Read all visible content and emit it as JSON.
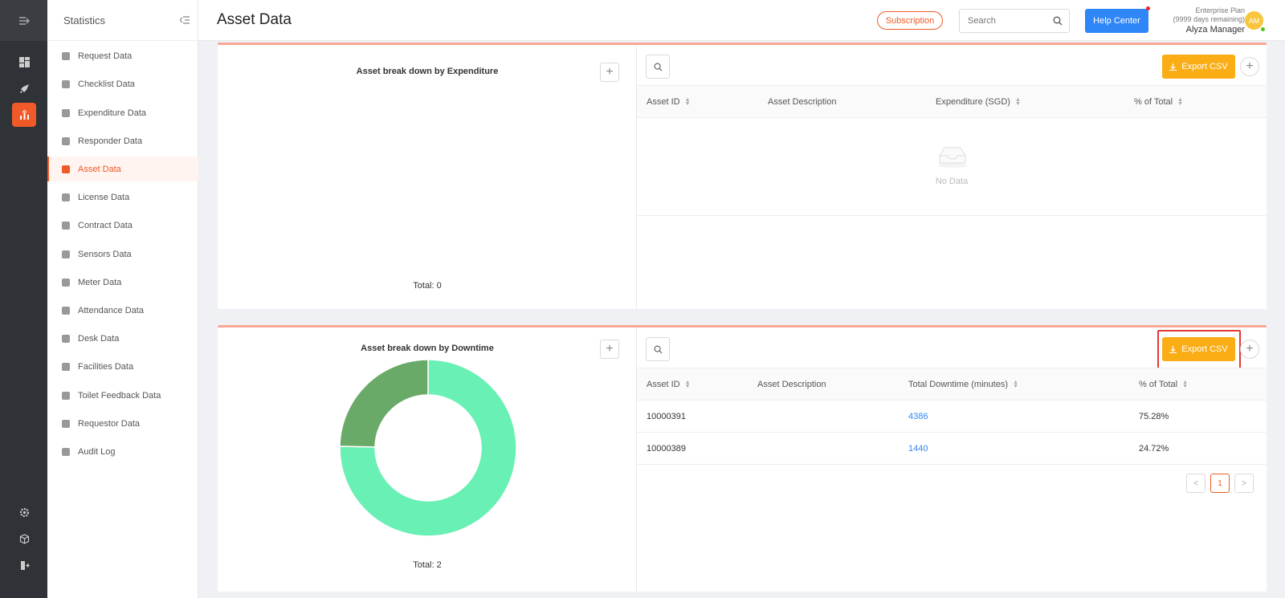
{
  "header": {
    "title": "Asset Data",
    "subscription_label": "Subscription",
    "search_placeholder": "Search",
    "help_label": "Help Center",
    "plan_name": "Enterprise Plan",
    "plan_remaining": "(9999 days remaining)",
    "user_name": "Alyza Manager",
    "avatar_initials": "AM"
  },
  "sidebar": {
    "title": "Statistics",
    "items": [
      {
        "label": "Request Data",
        "icon": "question-icon"
      },
      {
        "label": "Checklist Data",
        "icon": "checklist-icon"
      },
      {
        "label": "Expenditure Data",
        "icon": "wallet-icon"
      },
      {
        "label": "Responder Data",
        "icon": "user-icon"
      },
      {
        "label": "Asset Data",
        "icon": "asset-icon",
        "active": true
      },
      {
        "label": "License Data",
        "icon": "shield-icon"
      },
      {
        "label": "Contract Data",
        "icon": "contract-icon"
      },
      {
        "label": "Sensors Data",
        "icon": "wifi-icon"
      },
      {
        "label": "Meter Data",
        "icon": "gauge-icon"
      },
      {
        "label": "Attendance Data",
        "icon": "attendance-icon"
      },
      {
        "label": "Desk Data",
        "icon": "desk-icon"
      },
      {
        "label": "Facilities Data",
        "icon": "calendar-icon"
      },
      {
        "label": "Toilet Feedback Data",
        "icon": "list-icon"
      },
      {
        "label": "Requestor Data",
        "icon": "smile-icon"
      },
      {
        "label": "Audit Log",
        "icon": "log-icon"
      }
    ]
  },
  "expenditure_panel": {
    "chart_title": "Asset break down by Expenditure",
    "total": "Total: 0",
    "export_label": "Export CSV",
    "columns": [
      "Asset ID",
      "Asset Description",
      "Expenditure (SGD)",
      "% of Total"
    ],
    "empty_text": "No Data"
  },
  "downtime_panel": {
    "chart_title": "Asset break down by Downtime",
    "total": "Total: 2",
    "export_label": "Export CSV",
    "columns": [
      "Asset ID",
      "Asset Description",
      "Total Downtime (minutes)",
      "% of Total"
    ],
    "rows": [
      {
        "asset_id": "10000391",
        "description": "",
        "downtime": "4386",
        "percent": "75.28%"
      },
      {
        "asset_id": "10000389",
        "description": "",
        "downtime": "1440",
        "percent": "24.72%"
      }
    ],
    "current_page": "1"
  },
  "colors": {
    "accent": "#f05a28",
    "export": "#faad14",
    "help": "#2f86f6",
    "slice_large": "#69f0b4",
    "slice_small": "#6aaa68"
  },
  "chart_data": {
    "type": "pie",
    "title": "Asset break down by Downtime",
    "categories": [
      "10000391",
      "10000389"
    ],
    "values": [
      4386,
      1440
    ],
    "colors": [
      "#69f0b4",
      "#6aaa68"
    ],
    "donut": true
  }
}
